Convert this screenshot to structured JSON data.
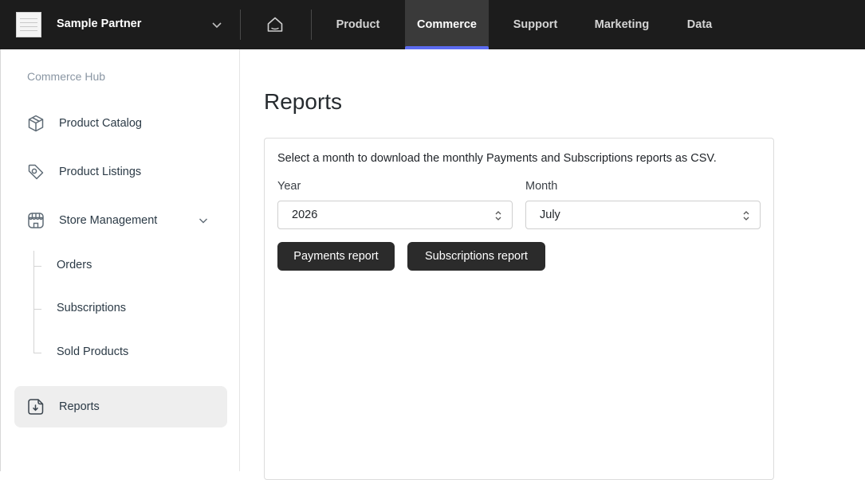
{
  "partner": {
    "name": "Sample Partner",
    "logo_icon": "partner-logo-icon"
  },
  "nav": {
    "home_icon": "home-icon",
    "tabs": [
      {
        "label": "Product",
        "active": false
      },
      {
        "label": "Commerce",
        "active": true
      },
      {
        "label": "Support",
        "active": false
      },
      {
        "label": "Marketing",
        "active": false
      },
      {
        "label": "Data",
        "active": false
      }
    ],
    "accent_color": "#5b6bf0"
  },
  "sidebar": {
    "title": "Commerce Hub",
    "items": [
      {
        "label": "Product Catalog",
        "icon": "box-icon"
      },
      {
        "label": "Product Listings",
        "icon": "tag-icon"
      },
      {
        "label": "Store Management",
        "icon": "store-icon",
        "expanded": true
      },
      {
        "label": "Reports",
        "icon": "report-download-icon",
        "active": true
      }
    ],
    "sub_items": [
      {
        "label": "Orders"
      },
      {
        "label": "Subscriptions"
      },
      {
        "label": "Sold Products"
      }
    ]
  },
  "main": {
    "title": "Reports",
    "description": "Select a month to download the monthly Payments and Subscriptions reports as CSV.",
    "year": {
      "label": "Year",
      "value": "2026"
    },
    "month": {
      "label": "Month",
      "value": "July"
    },
    "buttons": {
      "payments": "Payments report",
      "subscriptions": "Subscriptions report"
    }
  }
}
